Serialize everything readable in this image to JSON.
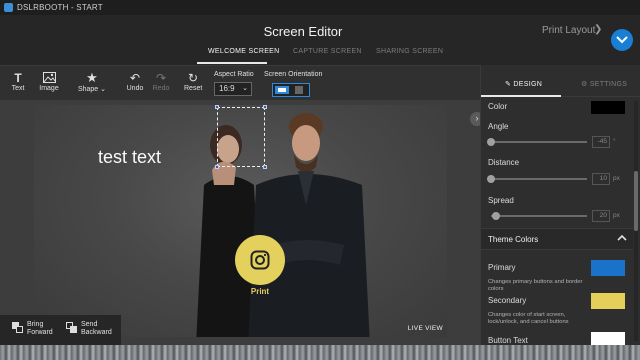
{
  "window": {
    "title": "DSLRBOOTH - START"
  },
  "header": {
    "title": "Screen Editor",
    "print_layout": "Print Layout"
  },
  "tabs": [
    {
      "label": "WELCOME SCREEN",
      "active": true
    },
    {
      "label": "CAPTURE SCREEN",
      "active": false
    },
    {
      "label": "SHARING SCREEN",
      "active": false
    }
  ],
  "toolbar": {
    "text": "Text",
    "image": "Image",
    "shape": "Shape",
    "undo": "Undo",
    "redo": "Redo",
    "reset": "Reset",
    "aspect_ratio_label": "Aspect Ratio",
    "aspect_ratio_value": "16:9",
    "orientation_label": "Screen Orientation"
  },
  "canvas": {
    "text_element": "test text",
    "print_label": "Print",
    "live_view": "LIVE VIEW"
  },
  "layer_actions": {
    "bring_forward_1": "Bring",
    "bring_forward_2": "Forward",
    "send_backward_1": "Send",
    "send_backward_2": "Backward"
  },
  "panel": {
    "tab_design": "DESIGN",
    "tab_settings": "SETTINGS",
    "color_label": "Color",
    "color_value": "#000000",
    "angle_label": "Angle",
    "angle_value": "-45",
    "angle_unit": "°",
    "angle_fraction": 0.0,
    "distance_label": "Distance",
    "distance_value": "10",
    "distance_unit": "px",
    "distance_fraction": 0.0,
    "spread_label": "Spread",
    "spread_value": "20",
    "spread_unit": "px",
    "spread_fraction": 0.05,
    "theme_colors_title": "Theme Colors",
    "primary_label": "Primary",
    "primary_desc": "Changes primary buttons and border colors",
    "primary_color": "#1a72c9",
    "secondary_label": "Secondary",
    "secondary_desc": "Changes color of start screen, lock/unlock, and cancel buttons",
    "secondary_color": "#e3cf5a",
    "button_text_label": "Button Text",
    "button_text_color": "#ffffff"
  }
}
